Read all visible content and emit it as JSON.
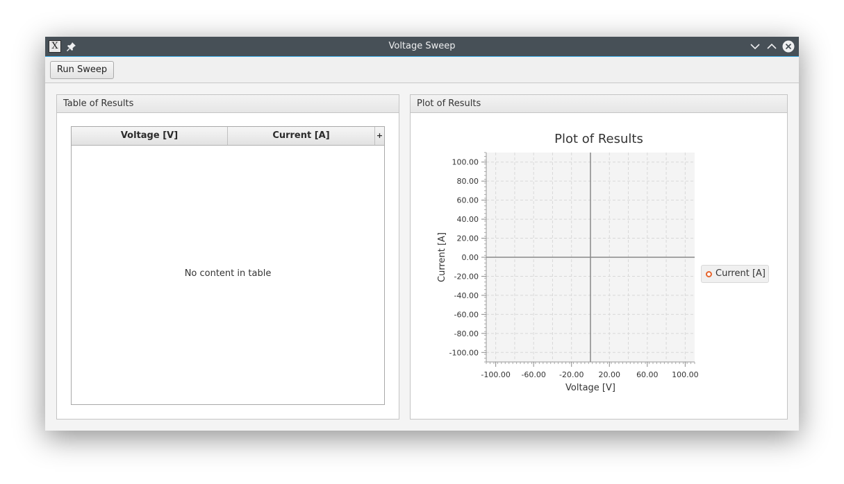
{
  "window": {
    "title": "Voltage Sweep"
  },
  "toolbar": {
    "run_label": "Run Sweep"
  },
  "table_panel": {
    "title": "Table of Results",
    "columns": [
      "Voltage [V]",
      "Current [A]"
    ],
    "add_column_glyph": "+",
    "empty_text": "No content in table",
    "rows": []
  },
  "plot_panel": {
    "title": "Plot of Results",
    "legend_label": "Current [A]"
  },
  "colors": {
    "series": "#e6642c",
    "titlebar": "#475057",
    "accent": "#3daee9"
  },
  "chart_data": {
    "type": "scatter",
    "title": "Plot of Results",
    "xlabel": "Voltage [V]",
    "ylabel": "Current [A]",
    "xlim": [
      -110,
      110
    ],
    "ylim": [
      -110,
      110
    ],
    "x_ticks": [
      "-100.00",
      "-60.00",
      "-20.00",
      "20.00",
      "60.00",
      "100.00"
    ],
    "y_ticks": [
      "100.00",
      "80.00",
      "60.00",
      "40.00",
      "20.00",
      "0.00",
      "-20.00",
      "-40.00",
      "-60.00",
      "-80.00",
      "-100.00"
    ],
    "grid": true,
    "legend_position": "right",
    "series": [
      {
        "name": "Current [A]",
        "x": [],
        "y": []
      }
    ]
  }
}
